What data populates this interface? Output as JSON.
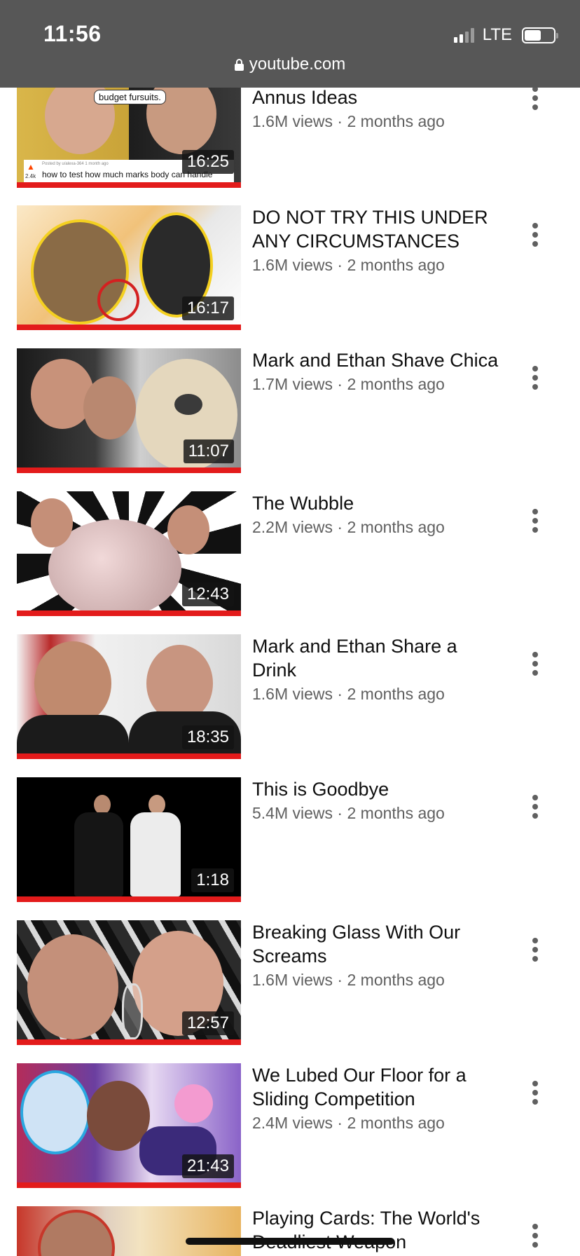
{
  "status_bar": {
    "time": "11:56",
    "network": "LTE",
    "signal_bars_active": 2,
    "battery_level": 0.5
  },
  "browser": {
    "url": "youtube.com",
    "icon": "lock-icon"
  },
  "videos": [
    {
      "title": "Annus Ideas",
      "meta": "1.6M views · 2 months ago",
      "duration": "16:25",
      "thumb_caption": "budget fursuits.",
      "thumb_post": "how to test how much marks body can handle",
      "thumb_votes": "2.4k",
      "thumb_postinfo": "Posted by u/alexa-364 1 month ago"
    },
    {
      "title": "DO NOT TRY THIS UNDER ANY CIRCUMSTANCES",
      "meta": "1.6M views · 2 months ago",
      "duration": "16:17"
    },
    {
      "title": "Mark and Ethan Shave Chica",
      "meta": "1.7M views · 2 months ago",
      "duration": "11:07"
    },
    {
      "title": "The Wubble",
      "meta": "2.2M views · 2 months ago",
      "duration": "12:43"
    },
    {
      "title": "Mark and Ethan Share a Drink",
      "meta": "1.6M views · 2 months ago",
      "duration": "18:35"
    },
    {
      "title": "This is Goodbye",
      "meta": "5.4M views · 2 months ago",
      "duration": "1:18"
    },
    {
      "title": "Breaking Glass With Our Screams",
      "meta": "1.6M views · 2 months ago",
      "duration": "12:57"
    },
    {
      "title": "We Lubed Our Floor for a Sliding Competition",
      "meta": "2.4M views · 2 months ago",
      "duration": "21:43"
    },
    {
      "title": "Playing Cards: The World's Deadliest Weapon",
      "meta": "",
      "duration": ""
    }
  ],
  "colors": {
    "status_bar_bg": "#575757",
    "progress_red": "#e31b1b",
    "title_text": "#0f0f0f",
    "meta_text": "#606060"
  }
}
